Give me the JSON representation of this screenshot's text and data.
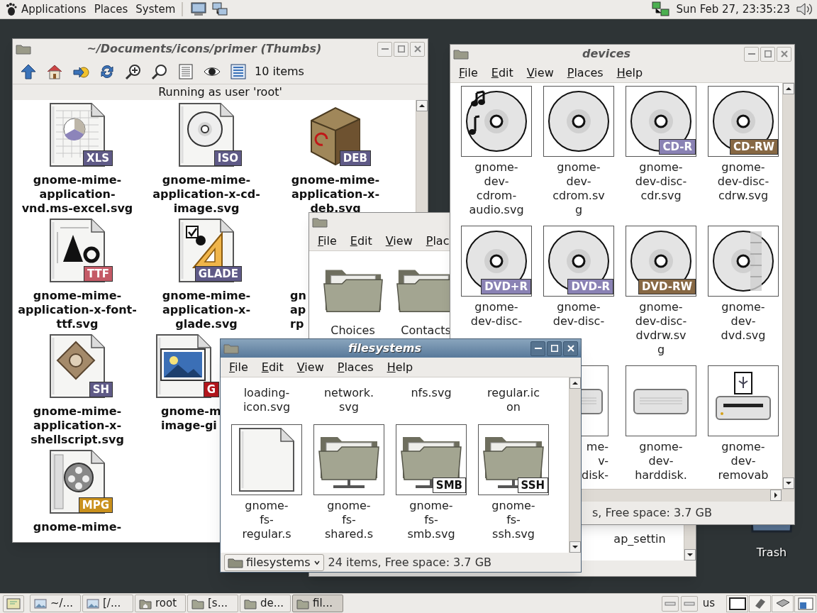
{
  "top_panel": {
    "menus": [
      "Applications",
      "Places",
      "System"
    ],
    "clock": "Sun Feb 27, 23:35:23"
  },
  "desktop": {
    "icons": [
      {
        "label": "Trash"
      }
    ]
  },
  "thumbs_window": {
    "title": "~/Documents/icons/primer (Thumbs)",
    "active": false,
    "item_count": "10 items",
    "status": "Running as user 'root'",
    "rows": [
      [
        {
          "kind": "spreadsheet-file",
          "badge": "XLS",
          "color": "#5f5a87",
          "label": "gnome-mime-application-vnd.ms-excel.svg"
        },
        {
          "kind": "disc-file",
          "badge": "ISO",
          "color": "#5f5a87",
          "label": "gnome-mime-application-x-cd-image.svg"
        },
        {
          "kind": "package",
          "badge": "DEB",
          "color": "#5f5a87",
          "label": "gnome-mime-application-x-deb.svg"
        }
      ],
      [
        {
          "kind": "font-file",
          "badge": "TTF",
          "color": "#c45a66",
          "label": "gnome-mime-application-x-font-ttf.svg"
        },
        {
          "kind": "glade-file",
          "badge": "GLADE",
          "color": "#5f5a87",
          "label": "gnome-mime-application-x-glade.svg"
        },
        {
          "label": "gn\nap\nrp",
          "hidden_right": true
        }
      ],
      [
        {
          "kind": "script-file",
          "badge": "SH",
          "color": "#5f5a87",
          "label": "gnome-mime-application-x-shellscript.svg"
        },
        {
          "kind": "image-file",
          "badge": "G",
          "color": "#b3161c",
          "label": "gnome-m\nimage-gi",
          "hidden_right": true
        }
      ],
      [
        {
          "kind": "video-file",
          "badge": "MPG",
          "color": "#c9901c",
          "label": "gnome-mime-"
        }
      ]
    ]
  },
  "home_window": {
    "active": false,
    "menus": [
      "File",
      "Edit",
      "View",
      "Plac"
    ],
    "items": [
      {
        "kind": "folder",
        "label": "Choices"
      },
      {
        "kind": "folder",
        "label": "Contacts"
      }
    ],
    "partial_labels": [
      "ap_settin"
    ]
  },
  "devices_window": {
    "title": "devices",
    "active": false,
    "menus": [
      "File",
      "Edit",
      "View",
      "Places",
      "Help"
    ],
    "rows": [
      [
        {
          "kind": "audio-disc",
          "label": "gnome-dev-cdrom-audio.svg"
        },
        {
          "kind": "disc",
          "label": "gnome-dev-cdrom.svg"
        },
        {
          "kind": "disc",
          "badge": "CD-R",
          "color": "#8a82b4",
          "label": "gnome-dev-disc-cdr.svg"
        },
        {
          "kind": "disc",
          "badge": "CD-RW",
          "color": "#876844",
          "label": "gnome-dev-disc-cdrw.svg"
        }
      ],
      [
        {
          "kind": "disc",
          "badge": "DVD+R",
          "color": "#8a82b4",
          "label": "gnome-dev-disc-"
        },
        {
          "kind": "disc",
          "badge": "DVD-R",
          "color": "#8a82b4",
          "label": "gnome-dev-disc-"
        },
        {
          "kind": "disc",
          "badge": "DVD-RW",
          "color": "#876844",
          "label": "gnome-dev-disc-dvdrw.svg"
        },
        {
          "kind": "video-disc",
          "label": "gnome-dev-dvd.svg"
        }
      ],
      [
        "",
        {
          "kind": "drive",
          "label": "me-\nv-\ndisk-",
          "hidden_left": true
        },
        {
          "kind": "drive",
          "label": "gnome-dev-harddisk."
        },
        {
          "kind": "usb-drive",
          "label": "gnome-dev-removab"
        }
      ]
    ],
    "status": "s, Free space: 3.7 GB"
  },
  "filesystems_window": {
    "title": "filesystems",
    "active": true,
    "menus": [
      "File",
      "Edit",
      "View",
      "Places",
      "Help"
    ],
    "rows": [
      [
        {
          "label": "loading-icon.svg",
          "hidden_top": true
        },
        {
          "label": "network.svg",
          "hidden_top": true
        },
        {
          "label": "nfs.svg",
          "hidden_top": true
        },
        {
          "label": "regular.icon",
          "hidden_top": true
        }
      ],
      [
        {
          "kind": "plain-file",
          "label": "gnome-fs-regular.s"
        },
        {
          "kind": "network-folder",
          "label": "gnome-fs-shared.s"
        },
        {
          "kind": "network-folder",
          "badge": "SMB",
          "color": "#ffffff",
          "label": "gnome-fs-smb.svg"
        },
        {
          "kind": "network-folder",
          "badge": "SSH",
          "color": "#ffffff",
          "label": "gnome-fs-ssh.svg"
        }
      ]
    ],
    "location": "filesystems",
    "status": "24 items, Free space: 3.7 GB"
  },
  "taskbar": {
    "tasks": [
      {
        "kind": "viewer",
        "label": "~/...",
        "selected": false
      },
      {
        "kind": "viewer",
        "label": "[/...",
        "selected": false
      },
      {
        "kind": "home",
        "label": "root",
        "selected": false
      },
      {
        "kind": "folder",
        "label": "[s...",
        "selected": false
      },
      {
        "kind": "folder",
        "label": "de...",
        "selected": false
      },
      {
        "kind": "folder",
        "label": "fil...",
        "selected": true
      }
    ],
    "keyboard_layout": "us"
  }
}
